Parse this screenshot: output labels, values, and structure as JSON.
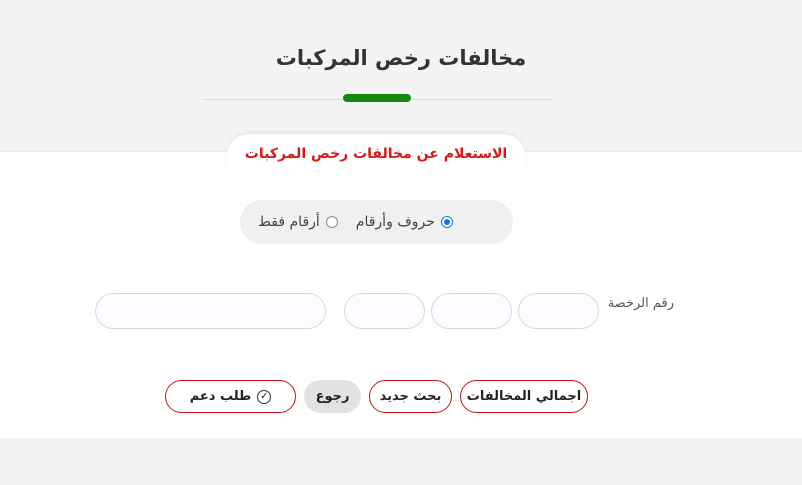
{
  "page": {
    "title": "مخالفات رخص المركبات"
  },
  "tab": {
    "label": "الاستعلام عن مخالفات رخص المركبات"
  },
  "plate_type": {
    "options": [
      {
        "label": "حروف وأرقام",
        "checked": true
      },
      {
        "label": "أرقام فقط",
        "checked": false
      }
    ]
  },
  "plate": {
    "label": "رقم الرخصة",
    "letter1": "",
    "letter2": "",
    "letter3": "",
    "number": ""
  },
  "buttons": {
    "total_violations": "اجمالي المخالفات",
    "new_search": "بحث جديد",
    "back": "رجوع",
    "support_request": "طلب دعم",
    "support_icon": "check-circle-icon"
  },
  "colors": {
    "accent_green": "#128a12",
    "accent_red": "#d81818",
    "radio_blue": "#1a73e8"
  }
}
